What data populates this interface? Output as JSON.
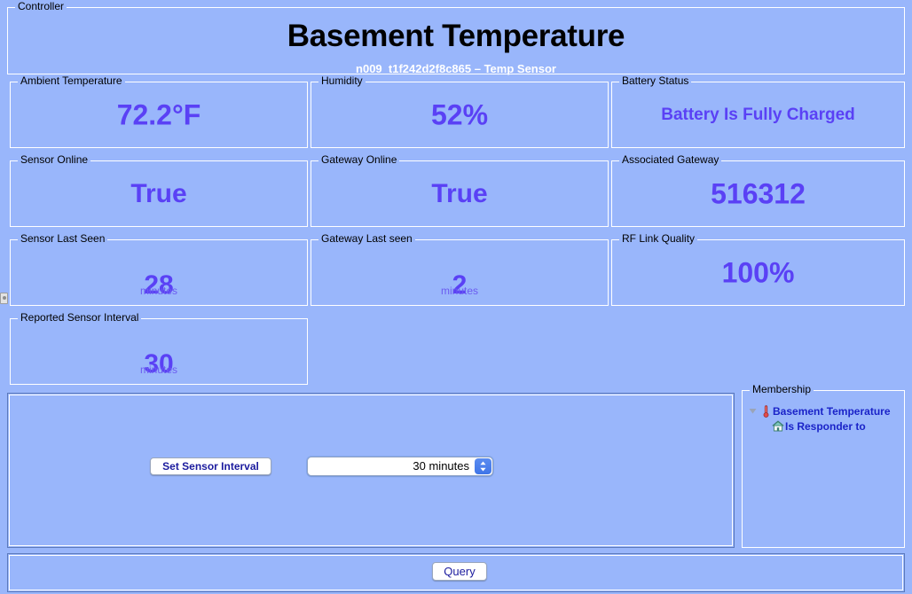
{
  "colors": {
    "background": "#99b6fb",
    "value_text": "#5a41f5",
    "unit_text": "#6b5bf0",
    "label_text": "#000000",
    "subtitle_text": "#ffffff",
    "button_text": "#1b1b9e",
    "tree_text": "#1a23c8",
    "stepper_blue": "#4a7fec"
  },
  "controller": {
    "group_label": "Controller",
    "title": "Basement Temperature",
    "subtitle": "n009_t1f242d2f8c865 – Temp Sensor"
  },
  "stats": [
    {
      "label": "Ambient Temperature",
      "value": "72.2°F",
      "unit": null,
      "size": "v-xl"
    },
    {
      "label": "Humidity",
      "value": "52%",
      "unit": null,
      "size": "v-xl"
    },
    {
      "label": "Battery Status",
      "value": "Battery Is Fully Charged",
      "unit": null,
      "size": "v-md"
    },
    {
      "label": "Sensor Online",
      "value": "True",
      "unit": null,
      "size": "v-lg"
    },
    {
      "label": "Gateway Online",
      "value": "True",
      "unit": null,
      "size": "v-lg"
    },
    {
      "label": "Associated Gateway",
      "value": "516312",
      "unit": null,
      "size": "v-xl"
    },
    {
      "label": "Sensor Last Seen",
      "value": "28",
      "unit": "minutes",
      "size": "v-num"
    },
    {
      "label": "Gateway Last seen",
      "value": "2",
      "unit": "minutes",
      "size": "v-num"
    },
    {
      "label": "RF Link Quality",
      "value": "100%",
      "unit": null,
      "size": "v-xl"
    },
    {
      "label": "Reported Sensor Interval",
      "value": "30",
      "unit": "minutes",
      "size": "v-num"
    }
  ],
  "controls": {
    "set_interval_label": "Set Sensor Interval",
    "interval_selected": "30 minutes",
    "interval_options": [
      "30 minutes"
    ]
  },
  "membership": {
    "group_label": "Membership",
    "items": [
      {
        "label": "Basement Temperature",
        "icon": "thermometer-icon",
        "expanded": true
      },
      {
        "label": "Is Responder to",
        "icon": "house-icon",
        "expanded": false
      }
    ]
  },
  "query": {
    "label": "Query"
  }
}
